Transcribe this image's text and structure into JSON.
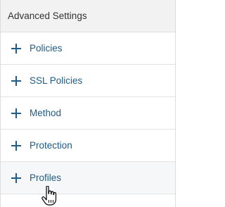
{
  "header": {
    "title": "Advanced Settings"
  },
  "items": [
    {
      "label": "Policies",
      "icon": "plus-icon"
    },
    {
      "label": "SSL Policies",
      "icon": "plus-icon"
    },
    {
      "label": "Method",
      "icon": "plus-icon"
    },
    {
      "label": "Protection",
      "icon": "plus-icon"
    },
    {
      "label": "Profiles",
      "icon": "plus-icon"
    }
  ],
  "colors": {
    "link": "#1f5b84",
    "header_bg": "#f2f2f2",
    "border": "#dcdcdc",
    "icon": "#1f5b84"
  },
  "cursor": "hand-pointer-icon"
}
